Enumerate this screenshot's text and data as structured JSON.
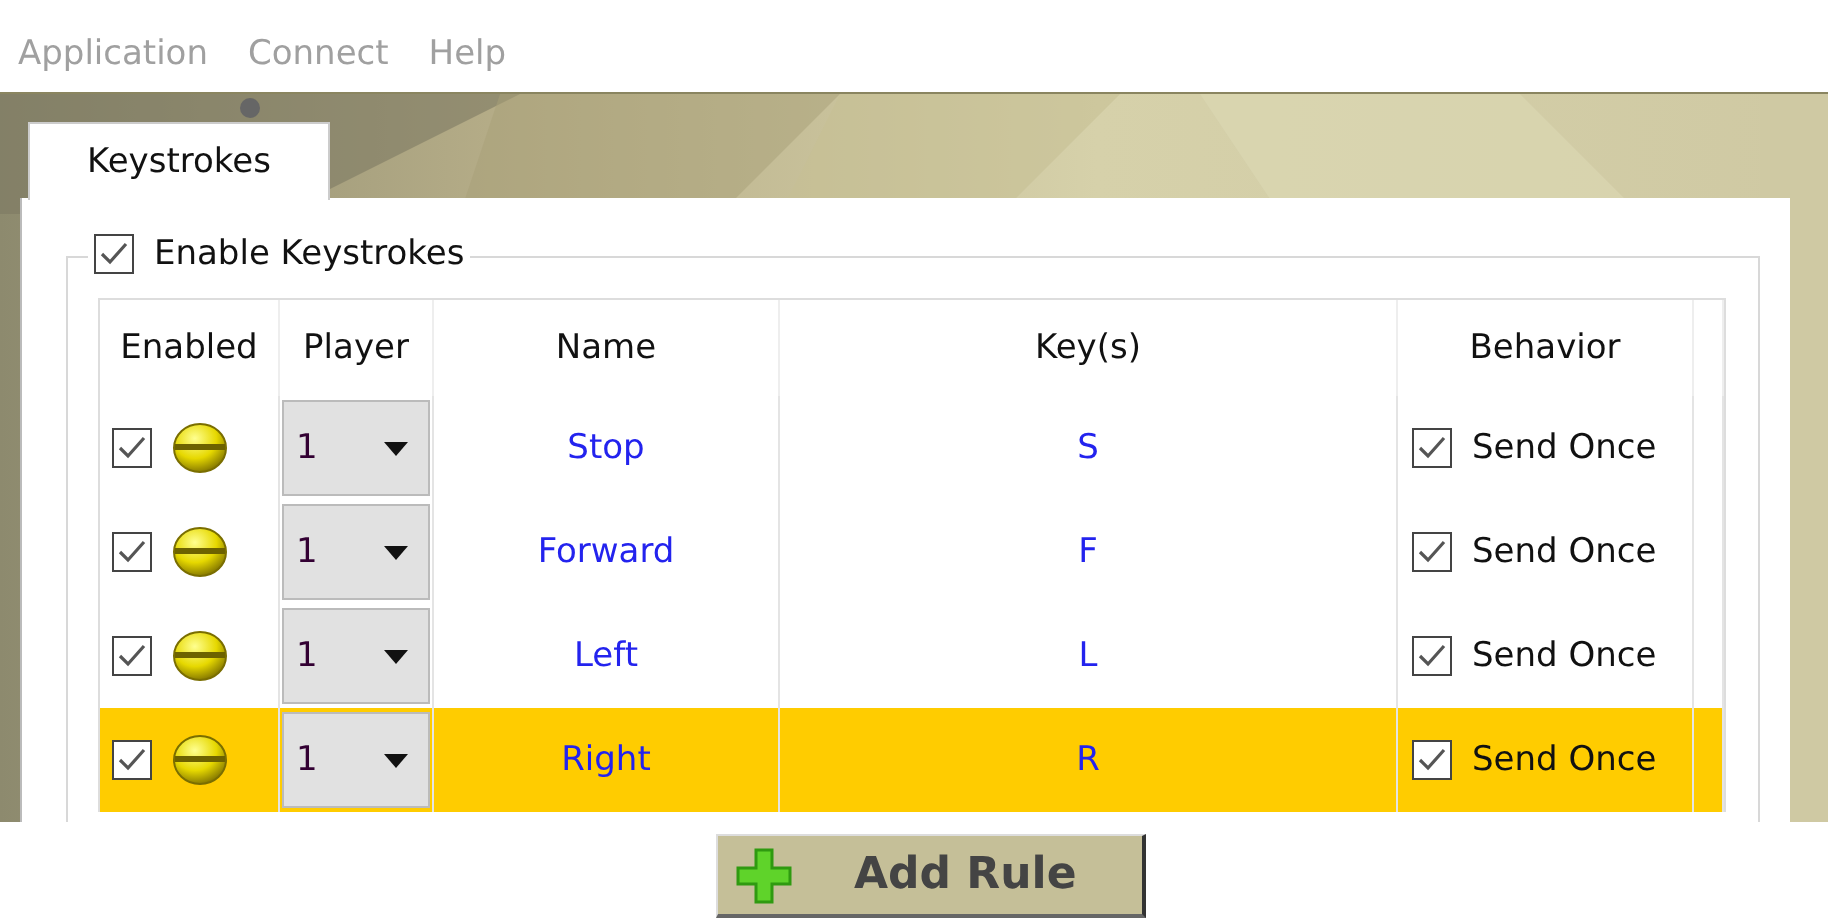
{
  "menu": [
    {
      "label": "Application"
    },
    {
      "label": "Connect"
    },
    {
      "label": "Help"
    }
  ],
  "tabs": [
    {
      "label": "Keystrokes",
      "selected": true
    }
  ],
  "group": {
    "label": "Enable Keystrokes",
    "checked": true
  },
  "table": {
    "columns": [
      "Enabled",
      "Player",
      "Name",
      "Key(s)",
      "Behavior"
    ],
    "rows": [
      {
        "enabled": true,
        "player": "1",
        "name": "Stop",
        "keys": "S",
        "behavior": "Send Once",
        "behavior_checked": true,
        "selected": false
      },
      {
        "enabled": true,
        "player": "1",
        "name": "Forward",
        "keys": "F",
        "behavior": "Send Once",
        "behavior_checked": true,
        "selected": false
      },
      {
        "enabled": true,
        "player": "1",
        "name": "Left",
        "keys": "L",
        "behavior": "Send Once",
        "behavior_checked": true,
        "selected": false
      },
      {
        "enabled": true,
        "player": "1",
        "name": "Right",
        "keys": "R",
        "behavior": "Send Once",
        "behavior_checked": true,
        "selected": true
      }
    ]
  },
  "add_button": {
    "label": "Add Rule"
  }
}
